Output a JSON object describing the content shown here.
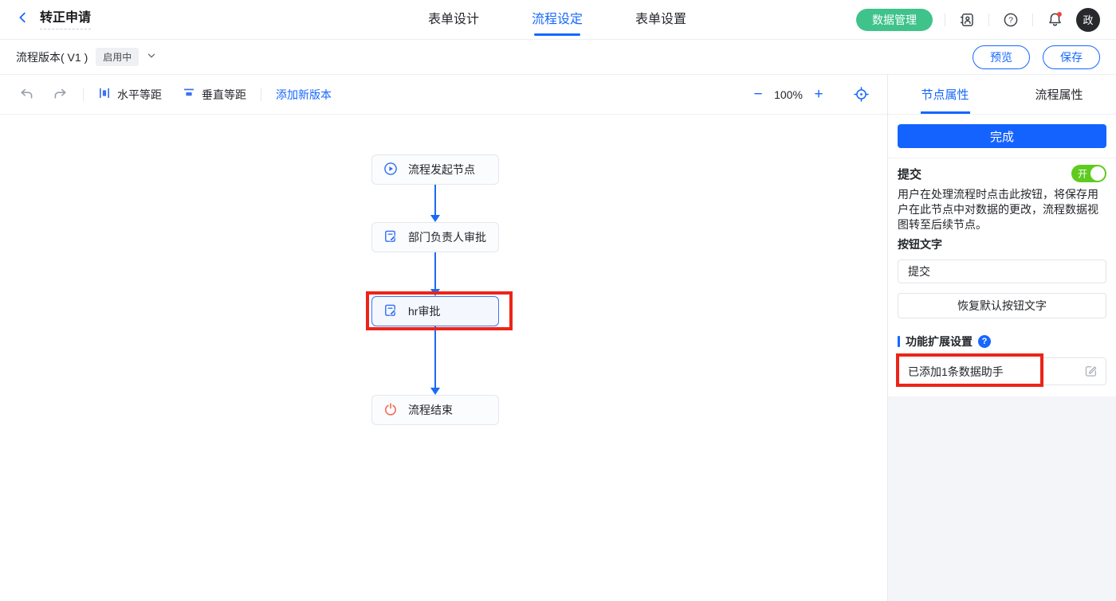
{
  "header": {
    "title": "转正申请",
    "tabs": [
      {
        "label": "表单设计"
      },
      {
        "label": "流程设定"
      },
      {
        "label": "表单设置"
      }
    ],
    "data_manage_label": "数据管理",
    "avatar_text": "政"
  },
  "version_bar": {
    "version_label": "流程版本( V1 )",
    "status_badge": "启用中",
    "preview_label": "预览",
    "save_label": "保存"
  },
  "toolbar": {
    "horizontal_label": "水平等距",
    "vertical_label": "垂直等距",
    "add_version_label": "添加新版本",
    "zoom_out": "−",
    "zoom_level": "100%",
    "zoom_in": "+"
  },
  "flow": {
    "nodes": [
      {
        "label": "流程发起节点",
        "icon": "play-icon"
      },
      {
        "label": "部门负责人审批",
        "icon": "doc-edit-icon"
      },
      {
        "label": "hr审批",
        "icon": "doc-edit-icon",
        "selected": true,
        "annotated": true
      },
      {
        "label": "流程结束",
        "icon": "power-icon"
      }
    ]
  },
  "panel": {
    "tabs": [
      {
        "label": "节点属性"
      },
      {
        "label": "流程属性"
      }
    ],
    "complete_button": "完成",
    "submit_label": "提交",
    "toggle_state": "开",
    "description": "用户在处理流程时点击此按钮，将保存用户在此节点中对数据的更改，流程数据视图转至后续节点。",
    "button_text_label": "按钮文字",
    "button_text_value": "提交",
    "restore_button": "恢复默认按钮文字",
    "extension_title": "功能扩展设置",
    "extension_field_value": "已添加1条数据助手"
  },
  "colors": {
    "primary_blue": "#1667ff",
    "green_pill": "#3fc38b",
    "toggle_green": "#5ecb1e",
    "annotation_red": "#ec2418",
    "end_node_red": "#f56a5a"
  }
}
